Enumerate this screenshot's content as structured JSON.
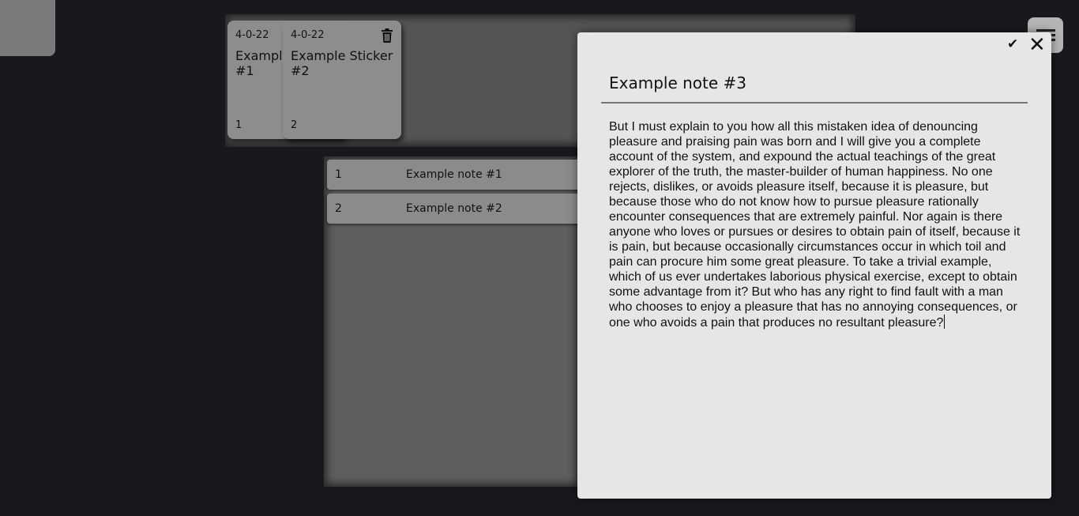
{
  "stickers": [
    {
      "date": "4-0-22",
      "title": "Example Sticker #1",
      "count": "1"
    },
    {
      "date": "4-0-22",
      "title": "Example Sticker #2",
      "count": "2",
      "delete_icon": "trash-icon"
    }
  ],
  "notes_list": [
    {
      "index": "1",
      "title": "Example note #1"
    },
    {
      "index": "2",
      "title": "Example note #2"
    }
  ],
  "menu": {
    "icon": "menu-icon"
  },
  "editor": {
    "title": "Example note #3",
    "confirm_icon": "check-icon",
    "close_icon": "close-icon",
    "body": "But I must explain to you how all this mistaken idea of denouncing pleasure and praising pain was born and I will give you a complete account of the system, and expound the actual teachings of the great explorer of the truth, the master-builder of human happiness. No one rejects, dislikes, or avoids pleasure itself, because it is pleasure, but because those who do not know how to pursue pleasure rationally encounter consequences that are extremely painful. Nor again is there anyone who loves or pursues or desires to obtain pain of itself, because it is pain, but because occasionally circumstances occur in which toil and pain can procure him some great pleasure. To take a trivial example, which of us ever undertakes laborious physical exercise, except to obtain some advantage from it? But who has any right to find fault with a man who chooses to enjoy a pleasure that has no annoying consequences, or one who avoids a pain that produces no resultant pleasure?"
  }
}
